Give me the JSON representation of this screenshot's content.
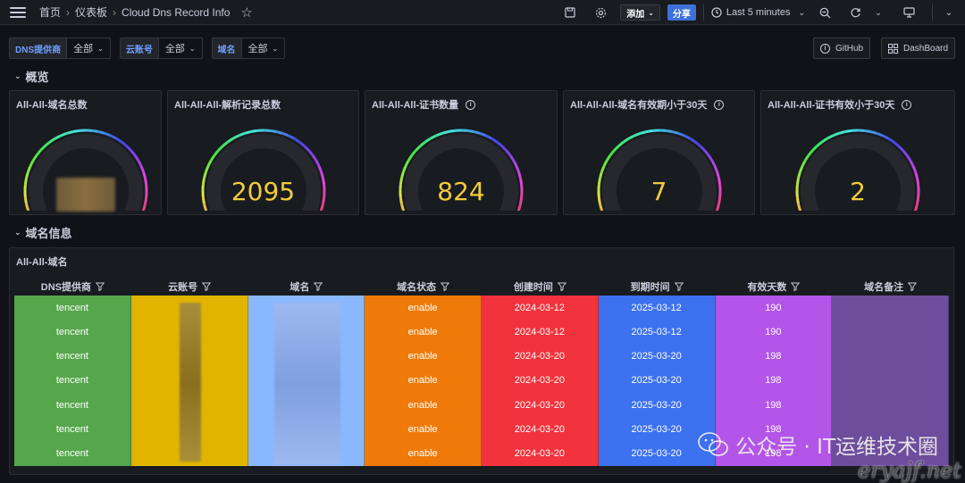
{
  "topbar": {
    "breadcrumbs": [
      "首页",
      "仪表板",
      "Cloud Dns Record Info"
    ],
    "add_label": "添加",
    "share_label": "分享",
    "time_range": "Last 5 minutes"
  },
  "variables": [
    {
      "label": "DNS提供商",
      "value": "全部"
    },
    {
      "label": "云账号",
      "value": "全部"
    },
    {
      "label": "域名",
      "value": "全部"
    }
  ],
  "links": {
    "github": "GitHub",
    "dashboard": "DashBoard"
  },
  "rows": {
    "overview": "概览",
    "domain_info": "域名信息"
  },
  "stats": [
    {
      "title": "All-All-域名总数",
      "value": "",
      "has_info": false
    },
    {
      "title": "All-All-All-解析记录总数",
      "value": "2095",
      "has_info": false
    },
    {
      "title": "All-All-All-证书数量",
      "value": "824",
      "has_info": true
    },
    {
      "title": "All-All-All-域名有效期小于30天",
      "value": "7",
      "has_info": true
    },
    {
      "title": "All-All-All-证书有效小于30天",
      "value": "2",
      "has_info": true
    }
  ],
  "table": {
    "title": "All-All-域名",
    "columns": [
      "DNS提供商",
      "云账号",
      "域名",
      "域名状态",
      "创建时间",
      "到期时间",
      "有效天数",
      "域名备注"
    ],
    "column_colors": [
      "#56a64b",
      "#e0b400",
      "#8ab8ff",
      "#f07a07",
      "#f2323c",
      "#3d71f0",
      "#b355e8",
      "#6e4d9c"
    ],
    "rows": [
      [
        "tencent",
        "",
        "",
        "enable",
        "2024-03-12",
        "2025-03-12",
        "190",
        ""
      ],
      [
        "tencent",
        "",
        "",
        "enable",
        "2024-03-12",
        "2025-03-12",
        "190",
        ""
      ],
      [
        "tencent",
        "",
        "",
        "enable",
        "2024-03-20",
        "2025-03-20",
        "198",
        ""
      ],
      [
        "tencent",
        "",
        "",
        "enable",
        "2024-03-20",
        "2025-03-20",
        "198",
        ""
      ],
      [
        "tencent",
        "",
        "",
        "enable",
        "2024-03-20",
        "2025-03-20",
        "198",
        ""
      ],
      [
        "tencent",
        "",
        "",
        "enable",
        "2024-03-20",
        "2025-03-20",
        "198",
        ""
      ],
      [
        "tencent",
        "",
        "",
        "enable",
        "2024-03-20",
        "2025-03-20",
        "198",
        ""
      ]
    ]
  },
  "watermark": {
    "text": "公众号 · IT运维技术圈",
    "sub": "eryajf.net"
  }
}
